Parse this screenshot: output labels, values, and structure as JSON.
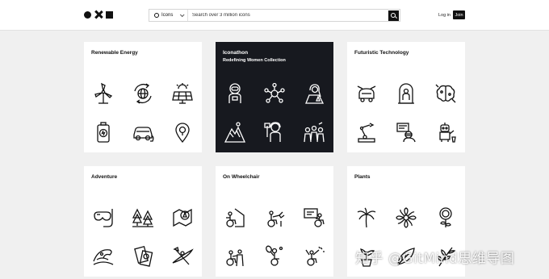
{
  "header": {
    "search_type_label": "Icons",
    "search_placeholder": "Search over 3 million icons",
    "login_label": "Log in",
    "join_label": "Join"
  },
  "collections": [
    {
      "title": "Renewable Energy",
      "subtitle": "",
      "icons": [
        "wind-turbine-icon",
        "globe-recycle-icon",
        "solar-panel-icon",
        "battery-charge-icon",
        "electric-car-icon",
        "bulb-pin-icon"
      ]
    },
    {
      "title": "Iconathon",
      "subtitle": "Redefining Women Collection",
      "icons": [
        "astronaut-icon",
        "network-people-icon",
        "woman-scientist-icon",
        "mountain-climber-icon",
        "protester-icon",
        "group-women-icon"
      ]
    },
    {
      "title": "Futuristic Technology",
      "subtitle": "",
      "icons": [
        "flying-car-icon",
        "capsule-pod-icon",
        "brain-circuit-icon",
        "robot-arm-icon",
        "vr-monitor-icon",
        "robot-helper-icon"
      ]
    },
    {
      "title": "Adventure",
      "subtitle": "",
      "icons": [
        "snorkel-mask-icon",
        "forest-icon",
        "compass-map-icon",
        "surfing-wave-icon",
        "passport-icon",
        "kayak-icon"
      ]
    },
    {
      "title": "On Wheelchair",
      "subtitle": "",
      "icons": [
        "wheelchair-house-icon",
        "wheelchair-watering-icon",
        "wheelchair-presentation-icon",
        "wheelchair-group-icon",
        "wheelchair-tennis-icon",
        "wheelchair-celebration-icon"
      ]
    },
    {
      "title": "Plants",
      "subtitle": "",
      "icons": [
        "palm-tree-icon",
        "lotus-flower-icon",
        "sunflower-icon",
        "potted-plant-icon",
        "leaf-sprout-icon",
        "herb-branch-icon"
      ]
    }
  ],
  "watermark": "知乎 @GitMind思维导图"
}
